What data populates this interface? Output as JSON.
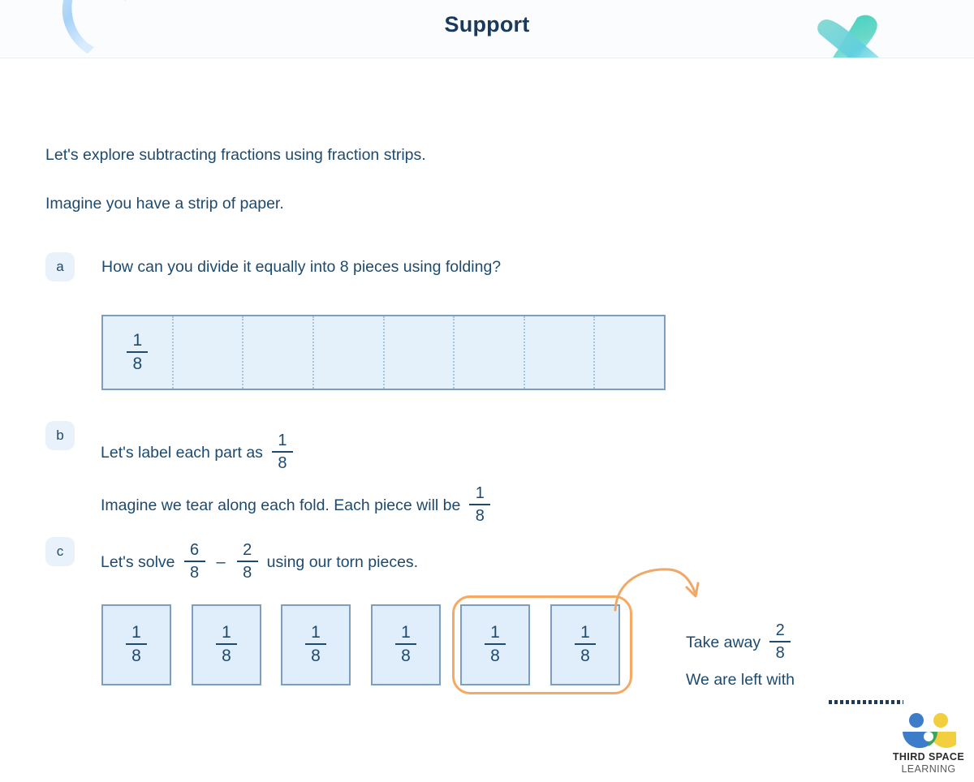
{
  "header": {
    "title": "Support",
    "decor_left_icon": "blue-swoosh-decoration",
    "decor_right_icon": "teal-cross-decoration",
    "background_color": "#fbfcfd",
    "title_color": "#1a3a5c"
  },
  "intro": {
    "line1": "Let's explore subtracting fractions using fraction strips.",
    "line2": "Imagine you have a strip of paper."
  },
  "questions": [
    {
      "label": "a",
      "text": "How can you divide it equally into 8 pieces using folding?"
    },
    {
      "label": "b",
      "line1_prefix": "Let's label each part as",
      "line1_fraction": {
        "numerator": "1",
        "denominator": "8"
      },
      "line2_prefix": "Imagine we tear along each fold. Each piece will be",
      "line2_fraction": {
        "numerator": "1",
        "denominator": "8"
      }
    },
    {
      "label": "c",
      "prefix": "Let's solve",
      "fraction_1": {
        "numerator": "6",
        "denominator": "8"
      },
      "operator": "–",
      "fraction_2": {
        "numerator": "2",
        "denominator": "8"
      },
      "suffix": "using our torn pieces."
    }
  ],
  "fraction_strip": {
    "total_parts": 8,
    "labeled_parts": 1,
    "part_fraction": {
      "numerator": "1",
      "denominator": "8"
    },
    "fill_color": "#e4f0fa",
    "border_color": "#7d9fbd",
    "divider_color": "#a9c6de",
    "cells": [
      {
        "numerator": "1",
        "denominator": "8",
        "labeled": true
      },
      {
        "numerator": "",
        "denominator": "",
        "labeled": false
      },
      {
        "numerator": "",
        "denominator": "",
        "labeled": false
      },
      {
        "numerator": "",
        "denominator": "",
        "labeled": false
      },
      {
        "numerator": "",
        "denominator": "",
        "labeled": false
      },
      {
        "numerator": "",
        "denominator": "",
        "labeled": false
      },
      {
        "numerator": "",
        "denominator": "",
        "labeled": false
      },
      {
        "numerator": "",
        "denominator": "",
        "labeled": false
      }
    ]
  },
  "torn_pieces": {
    "count": 6,
    "tiles": [
      {
        "numerator": "1",
        "denominator": "8",
        "highlighted": false
      },
      {
        "numerator": "1",
        "denominator": "8",
        "highlighted": false
      },
      {
        "numerator": "1",
        "denominator": "8",
        "highlighted": false
      },
      {
        "numerator": "1",
        "denominator": "8",
        "highlighted": false
      },
      {
        "numerator": "1",
        "denominator": "8",
        "highlighted": true
      },
      {
        "numerator": "1",
        "denominator": "8",
        "highlighted": true
      }
    ],
    "highlight_color": "#f5a962",
    "highlighted_count": 2,
    "tile_fill_color": "#e0eefb",
    "tile_border_color": "#7d9fbd"
  },
  "callout": {
    "take_away_label": "Take away",
    "take_away_fraction": {
      "numerator": "2",
      "denominator": "8"
    },
    "result_label": "We are left with",
    "answer_blank": "",
    "arrow_icon": "curved-arrow-icon",
    "arrow_color": "#f0a868"
  },
  "logo": {
    "name_line1": "THIRD SPACE",
    "name_line2": "LEARNING",
    "mark_icon": "third-space-learning-logo-icon",
    "colors": {
      "blue": "#3d7cc9",
      "yellow": "#f2cf3f",
      "green": "#3aa361"
    }
  }
}
